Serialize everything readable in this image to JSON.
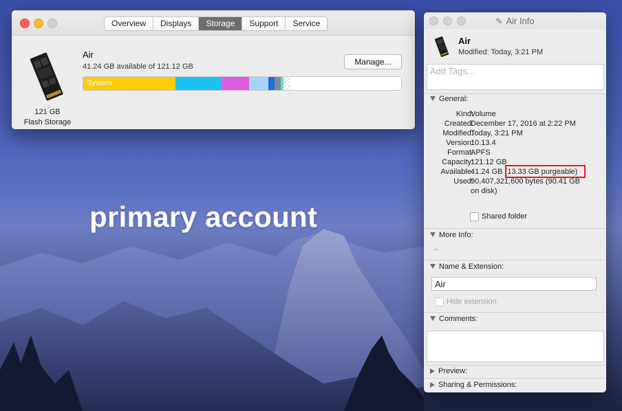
{
  "overlay_text": "primary account",
  "about_window": {
    "tabs": [
      {
        "label": "Overview",
        "active": false
      },
      {
        "label": "Displays",
        "active": false
      },
      {
        "label": "Storage",
        "active": true
      },
      {
        "label": "Support",
        "active": false
      },
      {
        "label": "Service",
        "active": false
      }
    ],
    "drive_caption_line1": "121 GB",
    "drive_caption_line2": "Flash Storage",
    "volume_name": "Air",
    "volume_available": "41.24 GB available of 121.12 GB",
    "manage_button": "Manage...",
    "storage_bar": {
      "first_label": "System",
      "segments": [
        {
          "color": "#fccb02",
          "fraction": 0.289
        },
        {
          "color": "#1ac3f2",
          "fraction": 0.143
        },
        {
          "color": "#db5fe0",
          "fraction": 0.089
        },
        {
          "color": "#a9d2f7",
          "fraction": 0.062
        },
        {
          "color": "#1d6fd8",
          "fraction": 0.019
        },
        {
          "color": "#7c8a98",
          "fraction": 0.019
        },
        {
          "color": "#5de3c4",
          "fraction": 0.008
        },
        {
          "color": "hatched",
          "fraction": 0.022
        }
      ]
    }
  },
  "info_window": {
    "title": "Air Info",
    "name": "Air",
    "modified_summary": "Modified: Today, 3:21 PM",
    "tags_placeholder": "Add Tags...",
    "general_header": "General:",
    "general": [
      {
        "key": "Kind:",
        "value": "Volume"
      },
      {
        "key": "Created:",
        "value": "December 17, 2016 at 2:22 PM"
      },
      {
        "key": "Modified:",
        "value": "Today, 3:21 PM"
      },
      {
        "key": "Version:",
        "value": "10.13.4"
      },
      {
        "key": "Format:",
        "value": "APFS"
      },
      {
        "key": "Capacity:",
        "value": "121.12 GB"
      },
      {
        "key": "Available:",
        "value": "41.24 GB (13.33 GB purgeable)"
      },
      {
        "key": "Used:",
        "value": "90,407,321,600 bytes (90.41 GB on disk)"
      }
    ],
    "shared_folder_label": "Shared folder",
    "more_info_header": "More Info:",
    "more_info_value": "--",
    "name_ext_header": "Name & Extension:",
    "name_field_value": "Air",
    "hide_extension_label": "Hide extension",
    "comments_header": "Comments:",
    "preview_header": "Preview:",
    "sharing_header": "Sharing & Permissions:"
  }
}
